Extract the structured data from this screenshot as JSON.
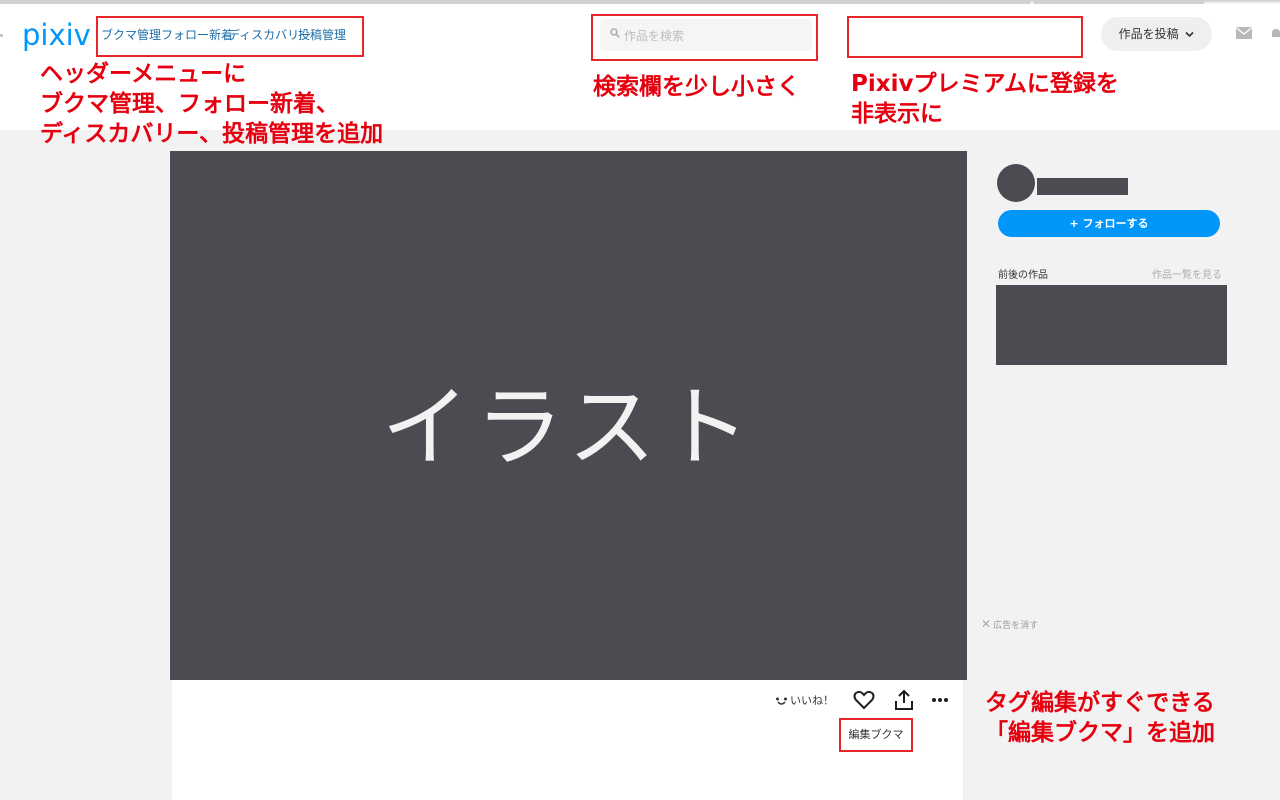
{
  "header": {
    "logo": "pixiv",
    "nav": [
      "ブクマ管理",
      "フォロー新着",
      "ディスカバリー",
      "投稿管理"
    ],
    "search_placeholder": "作品を検索",
    "post_button": "作品を投稿"
  },
  "annotations": {
    "nav": [
      "ヘッダーメニューに",
      "ブクマ管理、フォロー新着、",
      "ディスカバリー、投稿管理を追加"
    ],
    "search": "検索欄を少し小さく",
    "premium": [
      "Pixivプレミアムに登録を",
      "非表示に"
    ],
    "edit_bookmark": [
      "タグ編集がすぐできる",
      "「編集ブクマ」を追加"
    ]
  },
  "artwork": {
    "placeholder_text": "イラスト",
    "like_label": "いいね！",
    "edit_bookmark_label": "編集ブクマ"
  },
  "sidebar": {
    "follow_button": "+ フォローする",
    "works_title": "前後の作品",
    "works_link": "作品一覧を見る",
    "ad_hide": "広告を消す"
  },
  "colors": {
    "accent": "#0096fa",
    "annotation_red": "#e6000f",
    "placeholder_dark": "#4b4c51"
  }
}
